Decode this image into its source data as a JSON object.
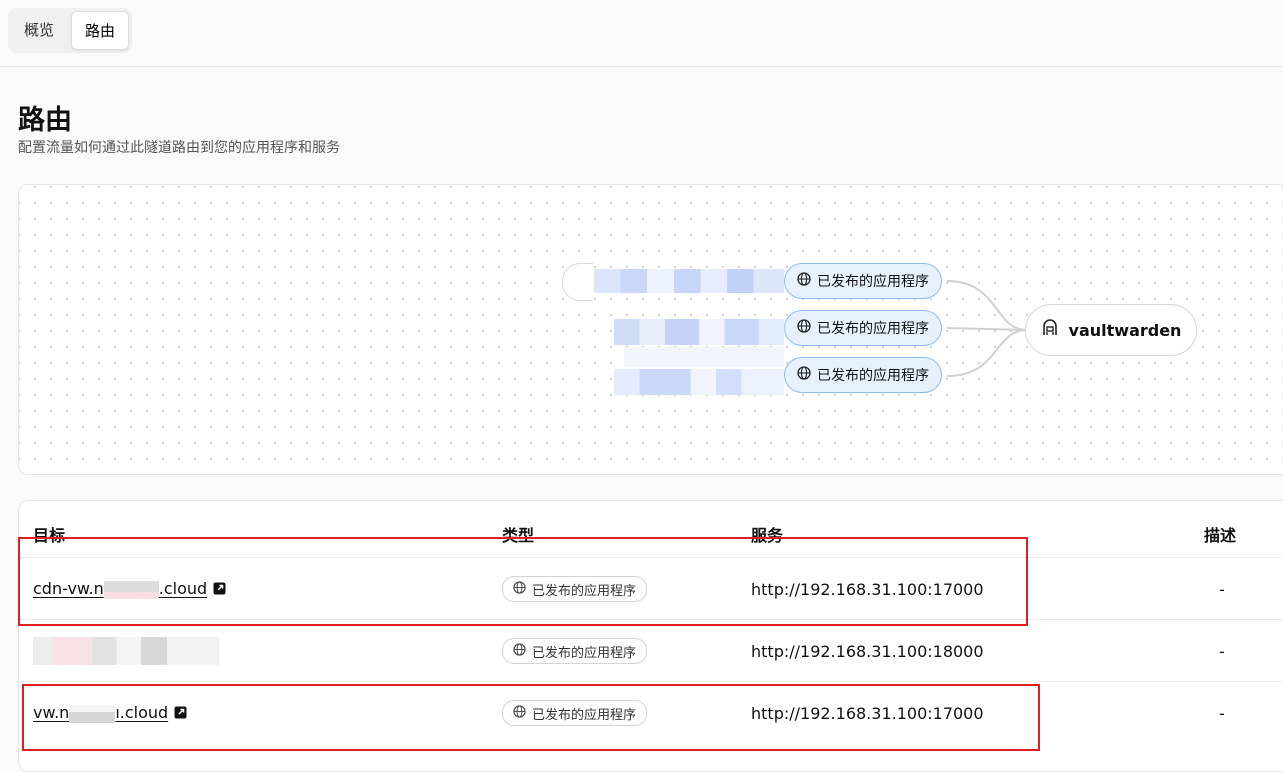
{
  "tabs": [
    "概览",
    "路由"
  ],
  "header": {
    "title": "路由",
    "subtitle": "配置流量如何通过此隧道路由到您的应用程序和服务"
  },
  "graph": {
    "app_nodes": [
      "已发布的应用程序",
      "已发布的应用程序",
      "已发布的应用程序"
    ],
    "service": "vaultwarden",
    "colors": {
      "node_fill": "#e6f1fd",
      "node_border": "#8bbcf0"
    }
  },
  "table": {
    "headers": {
      "target": "目标",
      "type": "类型",
      "service": "服务",
      "desc": "描述"
    },
    "rows": [
      {
        "target_prefix": "cdn-vw.n",
        "target_suffix": ".cloud",
        "type": "已发布的应用程序",
        "service": "http://192.168.31.100:17000",
        "desc": "-"
      },
      {
        "target_prefix": "",
        "target_suffix": "",
        "type": "已发布的应用程序",
        "service": "http://192.168.31.100:18000",
        "desc": "-"
      },
      {
        "target_prefix": "vw.n",
        "target_suffix": "ı.cloud",
        "type": "已发布的应用程序",
        "service": "http://192.168.31.100:17000",
        "desc": "-"
      }
    ]
  },
  "highlight_color": "#e02020"
}
